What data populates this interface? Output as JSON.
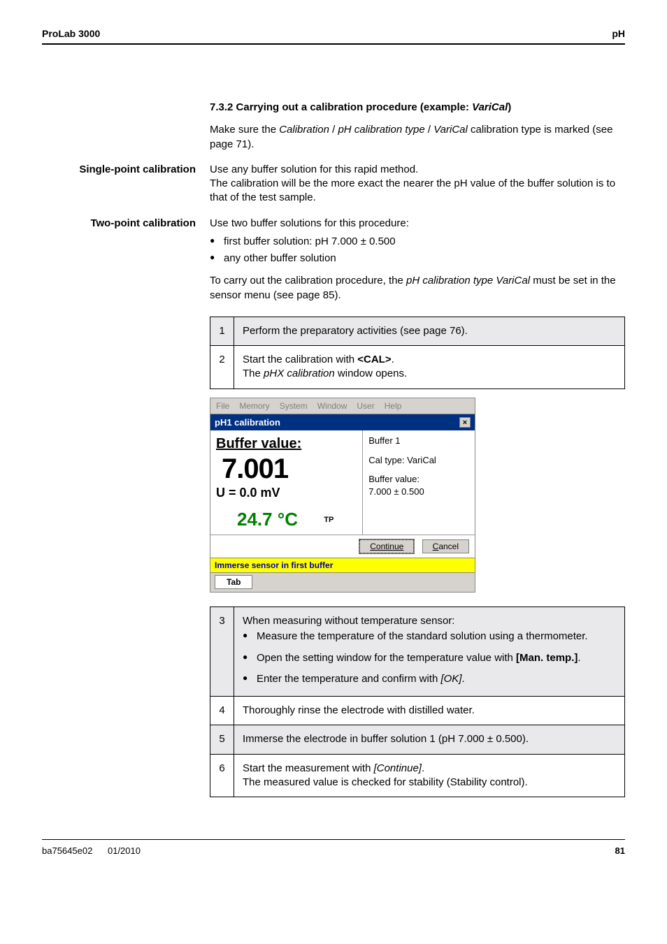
{
  "header": {
    "left": "ProLab 3000",
    "right": "pH"
  },
  "section": {
    "number_title": "7.3.2   Carrying out a calibration procedure (example: ",
    "varical": "VariCal",
    "title_close": ")",
    "intro_a": "Make sure the ",
    "intro_b": "Calibration",
    "intro_c": " / ",
    "intro_d": "pH calibration type",
    "intro_e": " / ",
    "intro_f": "VariCal",
    "intro_g": " calibration type is marked (see page 71)."
  },
  "single": {
    "label": "Single-point calibration",
    "p1": "Use any buffer solution for this rapid method.",
    "p2": "The calibration will be the more exact the nearer the pH value of the buffer solution is to that of the test sample."
  },
  "two": {
    "label": "Two-point calibration",
    "p1": "Use two buffer solutions for this procedure:",
    "b1": "first buffer solution: pH 7.000 ± 0.500",
    "b2": "any other buffer solution",
    "p2a": "To carry out the calibration procedure, the ",
    "p2b": "pH calibration type VariCal",
    "p2c": " must be set in the sensor menu (see page 85)."
  },
  "steps": {
    "s1": {
      "num": "1",
      "text": "Perform the preparatory activities (see page 76)."
    },
    "s2": {
      "num": "2",
      "t1": "Start the calibration with ",
      "key": "<CAL>",
      "t2": ".",
      "t3": "The ",
      "win": "pHX calibration",
      "t4": " window opens."
    },
    "s3": {
      "num": "3",
      "head": "When measuring without temperature sensor:",
      "b1": "Measure the temperature of the standard solution using a thermometer.",
      "b2a": "Open the setting window for the temperature value with ",
      "b2b": "[Man. temp.]",
      "b2c": ".",
      "b3a": "Enter the temperature and confirm with ",
      "b3b": "[OK]",
      "b3c": "."
    },
    "s4": {
      "num": "4",
      "text": "Thoroughly rinse the electrode with distilled water."
    },
    "s5": {
      "num": "5",
      "text": "Immerse the electrode in buffer solution 1 (pH 7.000 ± 0.500)."
    },
    "s6": {
      "num": "6",
      "t1": "Start the measurement with ",
      "key": "[Continue]",
      "t2": ".",
      "t3": "The measured value is checked for stability (Stability control)."
    }
  },
  "window": {
    "menu": {
      "file": "File",
      "memory": "Memory",
      "system": "System",
      "window": "Window",
      "user": "User",
      "help": "Help"
    },
    "title": "pH1 calibration",
    "close": "×",
    "buffer_label": "Buffer value:",
    "big_value": "7.001",
    "u_value": "U = 0.0 mV",
    "temp": "24.7 °C",
    "tp": "TP",
    "right": {
      "buffer": "Buffer 1",
      "caltype": "Cal type: VariCal",
      "bv_label": "Buffer value:",
      "bv_value": "7.000 ± 0.500"
    },
    "btn_continue": "Continue",
    "btn_cancel": "Cancel",
    "status": "Immerse sensor in first buffer",
    "tab": "Tab"
  },
  "footer": {
    "left1": "ba75645e02",
    "left2": "01/2010",
    "right": "81"
  }
}
